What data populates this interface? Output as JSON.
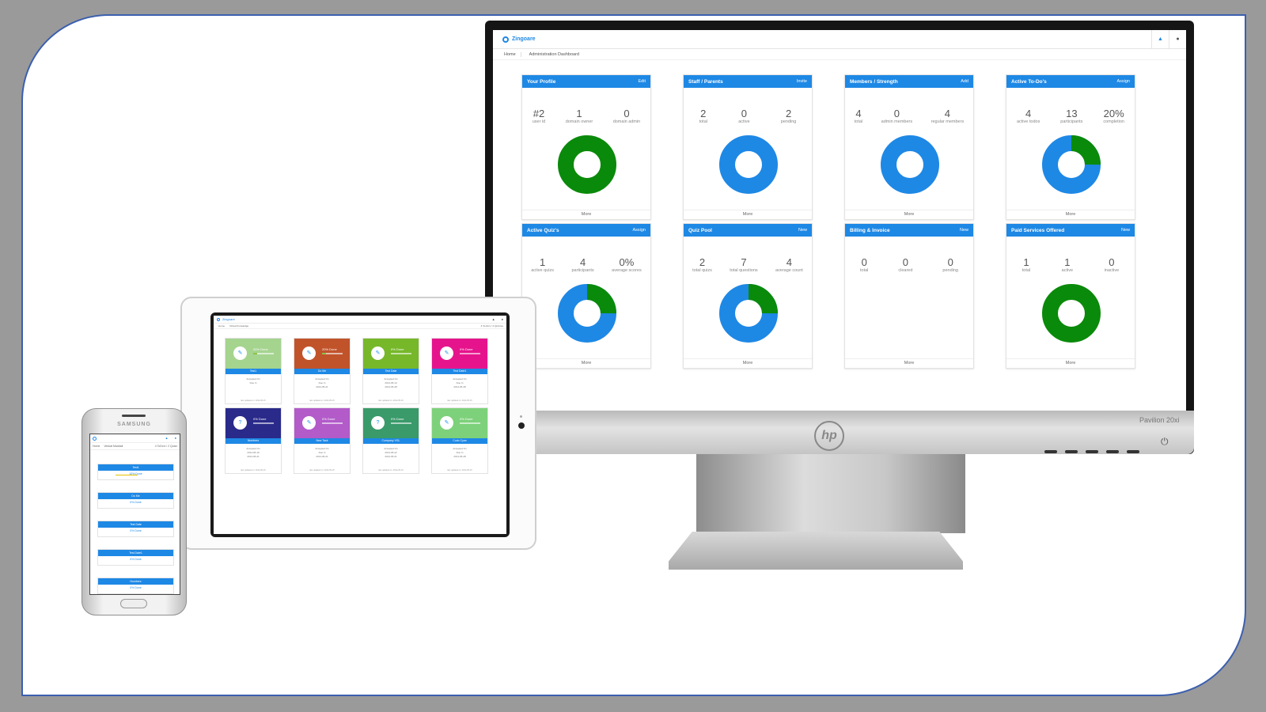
{
  "desktop": {
    "app_name": "Zingoare",
    "breadcrumb": [
      "Home",
      "Administration Dashboard"
    ],
    "brand": "hp",
    "model": "Pavilion 20xi",
    "cards": [
      {
        "title": "Your Profile",
        "action": "Edit",
        "stats": [
          {
            "num": "#2",
            "label": "user id"
          },
          {
            "num": "1",
            "label": "domain owner"
          },
          {
            "num": "0",
            "label": "domain admin"
          }
        ],
        "donut": {
          "blue": 0,
          "green": 100
        },
        "more": "More"
      },
      {
        "title": "Staff / Parents",
        "action": "Invite",
        "stats": [
          {
            "num": "2",
            "label": "total"
          },
          {
            "num": "0",
            "label": "active"
          },
          {
            "num": "2",
            "label": "pending"
          }
        ],
        "donut": {
          "blue": 100,
          "green": 0
        },
        "more": "More"
      },
      {
        "title": "Members / Strength",
        "action": "Add",
        "stats": [
          {
            "num": "4",
            "label": "total"
          },
          {
            "num": "0",
            "label": "admin members"
          },
          {
            "num": "4",
            "label": "regular members"
          }
        ],
        "donut": {
          "blue": 100,
          "green": 0
        },
        "more": "More"
      },
      {
        "title": "Active To-Do's",
        "action": "Assign",
        "stats": [
          {
            "num": "4",
            "label": "active todos"
          },
          {
            "num": "13",
            "label": "participants"
          },
          {
            "num": "20%",
            "label": "completion"
          }
        ],
        "donut": {
          "blue": 75,
          "green": 25
        },
        "more": "More"
      },
      {
        "title": "Active Quiz's",
        "action": "Assign",
        "stats": [
          {
            "num": "1",
            "label": "active quizs"
          },
          {
            "num": "4",
            "label": "participants"
          },
          {
            "num": "0%",
            "label": "average scores"
          }
        ],
        "donut": {
          "blue": 75,
          "green": 25
        },
        "more": "More"
      },
      {
        "title": "Quiz Pool",
        "action": "New",
        "stats": [
          {
            "num": "2",
            "label": "total quizs"
          },
          {
            "num": "7",
            "label": "total questions"
          },
          {
            "num": "4",
            "label": "average count"
          }
        ],
        "donut": {
          "blue": 75,
          "green": 25
        },
        "more": "More"
      },
      {
        "title": "Billing & Invoice",
        "action": "New",
        "stats": [
          {
            "num": "0",
            "label": "total"
          },
          {
            "num": "0",
            "label": "cleared"
          },
          {
            "num": "0",
            "label": "pending"
          }
        ],
        "donut": null,
        "more": "More"
      },
      {
        "title": "Paid Services Offered",
        "action": "New",
        "stats": [
          {
            "num": "1",
            "label": "total"
          },
          {
            "num": "1",
            "label": "active"
          },
          {
            "num": "0",
            "label": "inactive"
          }
        ],
        "donut": {
          "blue": 0,
          "green": 100
        },
        "more": "More"
      }
    ]
  },
  "tablet": {
    "app_name": "Zingoare",
    "breadcrumb": [
      "Home",
      "Virtual Knowledge"
    ],
    "breadcrumb_right": "4 To-Do's / 2 Quizzes",
    "cards": [
      {
        "name": "Test1",
        "done": "20% Done",
        "progress": 20,
        "color": "#a5d48f",
        "glyph": "✎",
        "accepted": "Accepted On",
        "due": "Due In",
        "date": "",
        "footer": "last updated on: 2014-05-15"
      },
      {
        "name": "Do Me",
        "done": "20% Done",
        "progress": 20,
        "color": "#c1532b",
        "glyph": "✎",
        "accepted": "Accepted On",
        "due": "Due In",
        "date": "2014-05-21",
        "footer": "last updated on: 2014-05-15"
      },
      {
        "name": "Test Date",
        "done": "0% Done",
        "progress": 0,
        "color": "#76b82a",
        "glyph": "✎",
        "accepted": "Accepted On",
        "due": "2014-05-14",
        "date": "2014-05-28",
        "footer": "last updated on: 2014-05-15"
      },
      {
        "name": "Test Date1",
        "done": "0% Done",
        "progress": 0,
        "color": "#e6148c",
        "glyph": "✎",
        "accepted": "Accepted On",
        "due": "Due In",
        "date": "2014-05-28",
        "footer": "last updated on: 2014-05-15"
      },
      {
        "name": "Numbers",
        "done": "0% Done",
        "progress": 0,
        "color": "#2a2a8a",
        "glyph": "?",
        "accepted": "Accepted On",
        "due": "2014-05-19",
        "date": "2014-05-21",
        "footer": "last updated on: 2014-05-15"
      },
      {
        "name": "New Task",
        "done": "0% Done",
        "progress": 0,
        "color": "#b25bc9",
        "glyph": "✎",
        "accepted": "Accepted On",
        "due": "Due In",
        "date": "2014-05-21",
        "footer": "last updated on: 2014-05-15"
      },
      {
        "name": "Company VGL",
        "done": "0% Done",
        "progress": 0,
        "color": "#3a9a6a",
        "glyph": "?",
        "accepted": "Accepted On",
        "due": "2014-05-22",
        "date": "2014-05-21",
        "footer": "last updated on: 2014-05-15"
      },
      {
        "name": "Cudo Cyan",
        "done": "0% Done",
        "progress": 0,
        "color": "#7dd17a",
        "glyph": "✎",
        "accepted": "Accepted On",
        "due": "Due In",
        "date": "2014-05-28",
        "footer": "last updated on: 2014-05-15"
      }
    ]
  },
  "phone": {
    "brand": "SAMSUNG",
    "breadcrumb": [
      "Home",
      "Venkat Maddali"
    ],
    "breadcrumb_right": "4 ToDo's / 2 Quizz",
    "cards": [
      {
        "name": "Test1",
        "done": "10% Done",
        "bar": true
      },
      {
        "name": "Do Me",
        "done": "0% Done",
        "bar": false
      },
      {
        "name": "Test Date",
        "done": "0% Done",
        "bar": false
      },
      {
        "name": "Test Date1",
        "done": "0% Done",
        "bar": false
      },
      {
        "name": "Numbers",
        "done": "0% Done",
        "bar": false
      }
    ]
  },
  "colors": {
    "accent": "#1e88e5",
    "green": "#0a8a0a",
    "frame_border": "#3b5fae"
  }
}
